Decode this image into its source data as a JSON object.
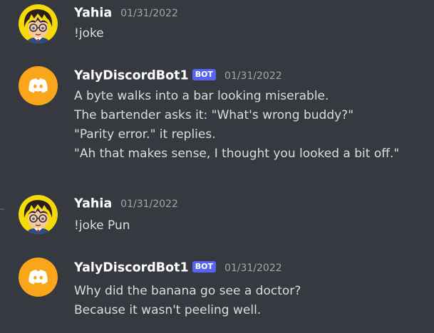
{
  "messages": [
    {
      "author": "Yahia",
      "bot_badge": "",
      "timestamp": "01/31/2022",
      "lines": [
        "!joke"
      ],
      "avatar": "user-avatar"
    },
    {
      "author": "YalyDiscordBot1",
      "bot_badge": "BOT",
      "timestamp": "01/31/2022",
      "lines": [
        "A byte walks into a bar looking miserable.",
        "The bartender asks it: \"What's wrong buddy?\"",
        "\"Parity error.\" it replies.",
        "\"Ah that makes sense, I thought you looked a bit off.\""
      ],
      "avatar": "discord-logo"
    },
    {
      "author": "Yahia",
      "bot_badge": "",
      "timestamp": "01/31/2022",
      "lines": [
        "!joke Pun"
      ],
      "avatar": "user-avatar"
    },
    {
      "author": "YalyDiscordBot1",
      "bot_badge": "BOT",
      "timestamp": "01/31/2022",
      "lines": [
        "Why did the banana go see a doctor?",
        "Because it wasn't peeling well."
      ],
      "avatar": "discord-logo"
    }
  ],
  "colors": {
    "background": "#36393f",
    "username": "#ffffff",
    "message_text": "#dcddde",
    "timestamp": "#a3a6aa",
    "bot_badge": "#5865f2",
    "bot_avatar_bg": "#faa61a"
  }
}
